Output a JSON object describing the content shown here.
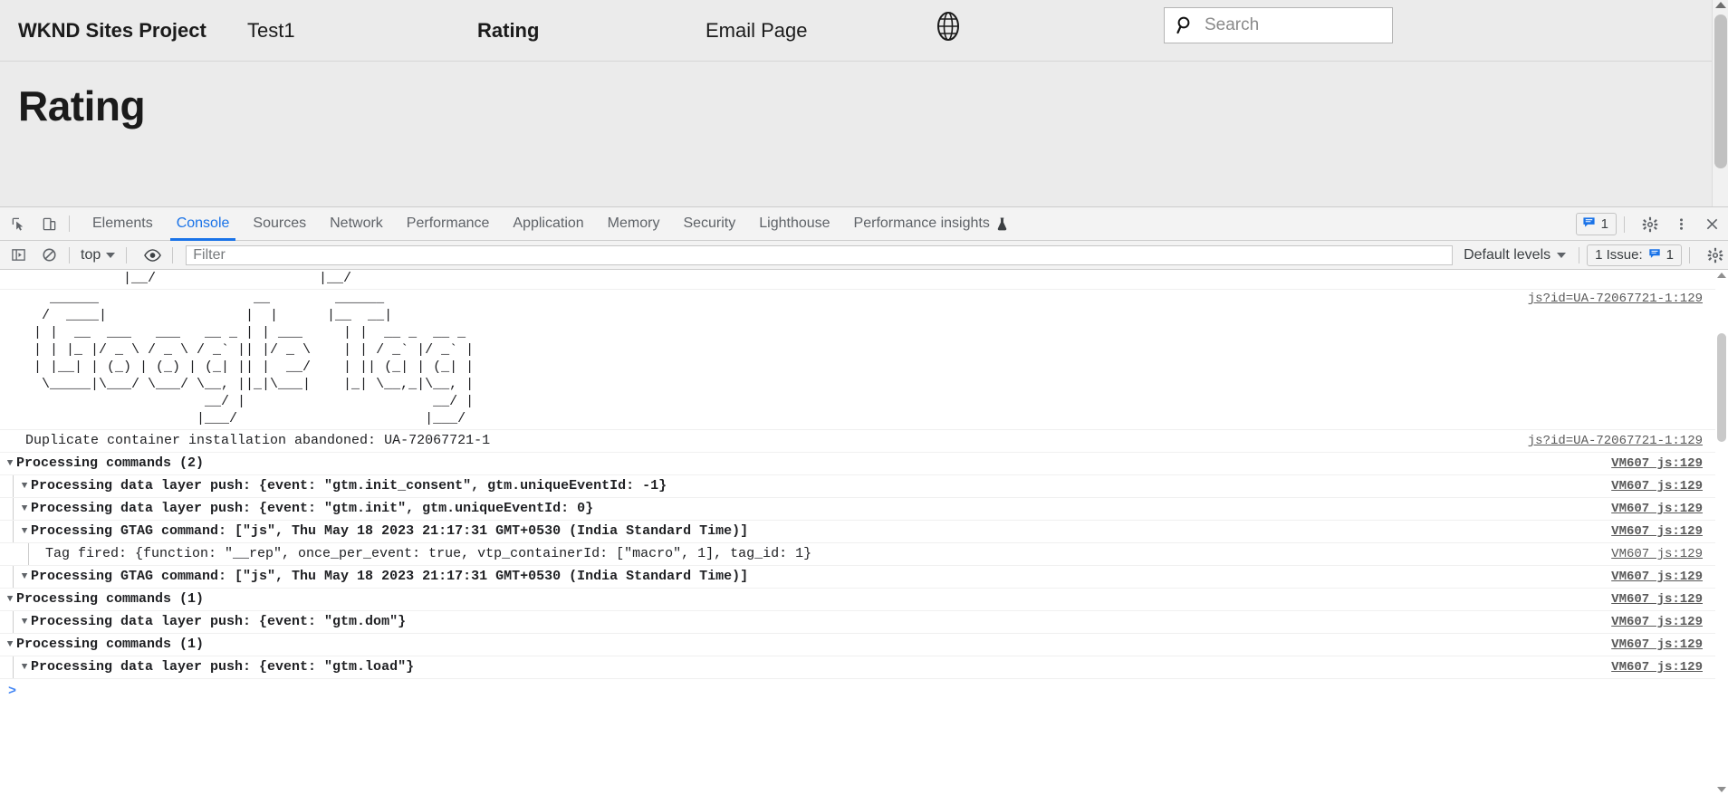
{
  "site": {
    "nav": [
      {
        "label": "WKND Sites Project",
        "bold": true
      },
      {
        "label": "Test1",
        "bold": false
      },
      {
        "label": "Rating",
        "bold": true
      },
      {
        "label": "Email Page",
        "bold": false
      }
    ],
    "globe_icon": "globe-icon",
    "search": {
      "icon": "search-icon",
      "placeholder": "Search",
      "value": ""
    },
    "page_title": "Rating"
  },
  "devtools": {
    "tools": {
      "inspect_icon": "inspect-element-icon",
      "device_icon": "device-toolbar-icon"
    },
    "tabs": [
      {
        "label": "Elements",
        "active": false
      },
      {
        "label": "Console",
        "active": true
      },
      {
        "label": "Sources",
        "active": false
      },
      {
        "label": "Network",
        "active": false
      },
      {
        "label": "Performance",
        "active": false
      },
      {
        "label": "Application",
        "active": false
      },
      {
        "label": "Memory",
        "active": false
      },
      {
        "label": "Security",
        "active": false
      },
      {
        "label": "Lighthouse",
        "active": false
      },
      {
        "label": "Performance insights",
        "active": false,
        "icon": "flask-icon"
      }
    ],
    "tabbar_right": {
      "issues_badge_icon": "issues-message-icon",
      "issues_badge_count": "1",
      "settings_icon": "gear-icon",
      "more_icon": "kebab-menu-icon",
      "close_icon": "close-icon"
    },
    "console_toolbar": {
      "sidebar_icon": "console-sidebar-icon",
      "clear_icon": "clear-console-icon",
      "context": "top",
      "eye_icon": "live-expression-eye-icon",
      "filter_placeholder": "Filter",
      "filter_value": "",
      "levels": "Default levels",
      "issues_label": "1 Issue:",
      "issues_icon": "issues-message-icon",
      "issues_count": "1",
      "settings_icon": "console-settings-gear-icon"
    },
    "messages": [
      {
        "id": "ascii-top",
        "type": "ascii-continuation",
        "text": "            |__/                    |__/",
        "link": "",
        "bold": false
      },
      {
        "id": "ascii-google-tag",
        "type": "ascii",
        "text": "   ______                   __        ______\n  /  ____|                 |  |      |__  __|\n | |  __  ___   ___   __ _ | | ___     | |  __ _  __ _\n | | |_ |/ _ \\ / _ \\ / _` || |/ _ \\    | | / _` |/ _` |\n | |__| | (_) | (_) | (_| || |  __/    | || (_| | (_| |\n  \\_____|\\___/ \\___/ \\__, ||_|\\___|    |_| \\__,_|\\__, |\n                      __/ |                       __/ |\n                     |___/                       |___/",
        "link": "js?id=UA-72067721-1:129",
        "bold": false
      },
      {
        "id": "duplicate-container",
        "type": "log",
        "indent": 0,
        "arrow": "",
        "text": "Duplicate container installation abandoned: UA-72067721-1",
        "link": "js?id=UA-72067721-1:129",
        "bold": false
      },
      {
        "id": "processing-commands-2",
        "type": "group",
        "indent": 0,
        "arrow": "▼",
        "text": "Processing commands (2)",
        "link": "VM607 js:129",
        "bold": true
      },
      {
        "id": "dl-push-init-consent",
        "type": "group",
        "indent": 1,
        "arrow": "▼",
        "text": "Processing data layer push: {event: \"gtm.init_consent\", gtm.uniqueEventId: -1}",
        "link": "VM607 js:129",
        "bold": true
      },
      {
        "id": "dl-push-init",
        "type": "group",
        "indent": 1,
        "arrow": "▼",
        "text": "Processing data layer push: {event: \"gtm.init\", gtm.uniqueEventId: 0}",
        "link": "VM607 js:129",
        "bold": true
      },
      {
        "id": "gtag-js-1",
        "type": "group",
        "indent": 1,
        "arrow": "▼",
        "text": "Processing GTAG command: [\"js\", Thu May 18 2023 21:17:31 GMT+0530 (India Standard Time)]",
        "link": "VM607 js:129",
        "bold": true
      },
      {
        "id": "tag-fired",
        "type": "log",
        "indent": 2,
        "arrow": "",
        "text": "Tag fired: {function: \"__rep\", once_per_event: true, vtp_containerId: [\"macro\", 1], tag_id: 1}",
        "link": "VM607 js:129",
        "bold": false
      },
      {
        "id": "gtag-js-2",
        "type": "group",
        "indent": 1,
        "arrow": "▼",
        "text": "Processing GTAG command: [\"js\", Thu May 18 2023 21:17:31 GMT+0530 (India Standard Time)]",
        "link": "VM607 js:129",
        "bold": true
      },
      {
        "id": "processing-commands-1a",
        "type": "group",
        "indent": 0,
        "arrow": "▼",
        "text": "Processing commands (1)",
        "link": "VM607 js:129",
        "bold": true
      },
      {
        "id": "dl-push-dom",
        "type": "group",
        "indent": 1,
        "arrow": "▼",
        "text": "Processing data layer push: {event: \"gtm.dom\"}",
        "link": "VM607 js:129",
        "bold": true
      },
      {
        "id": "processing-commands-1b",
        "type": "group",
        "indent": 0,
        "arrow": "▼",
        "text": "Processing commands (1)",
        "link": "VM607 js:129",
        "bold": true
      },
      {
        "id": "dl-push-load",
        "type": "group",
        "indent": 1,
        "arrow": "▼",
        "text": "Processing data layer push: {event: \"gtm.load\"}",
        "link": "VM607 js:129",
        "bold": true
      }
    ],
    "prompt": ">"
  },
  "colors": {
    "accent_blue": "#1a73e8",
    "page_bg": "#ebebeb",
    "devtools_bg": "#f3f3f3",
    "link_gray": "#5a5a5a"
  }
}
